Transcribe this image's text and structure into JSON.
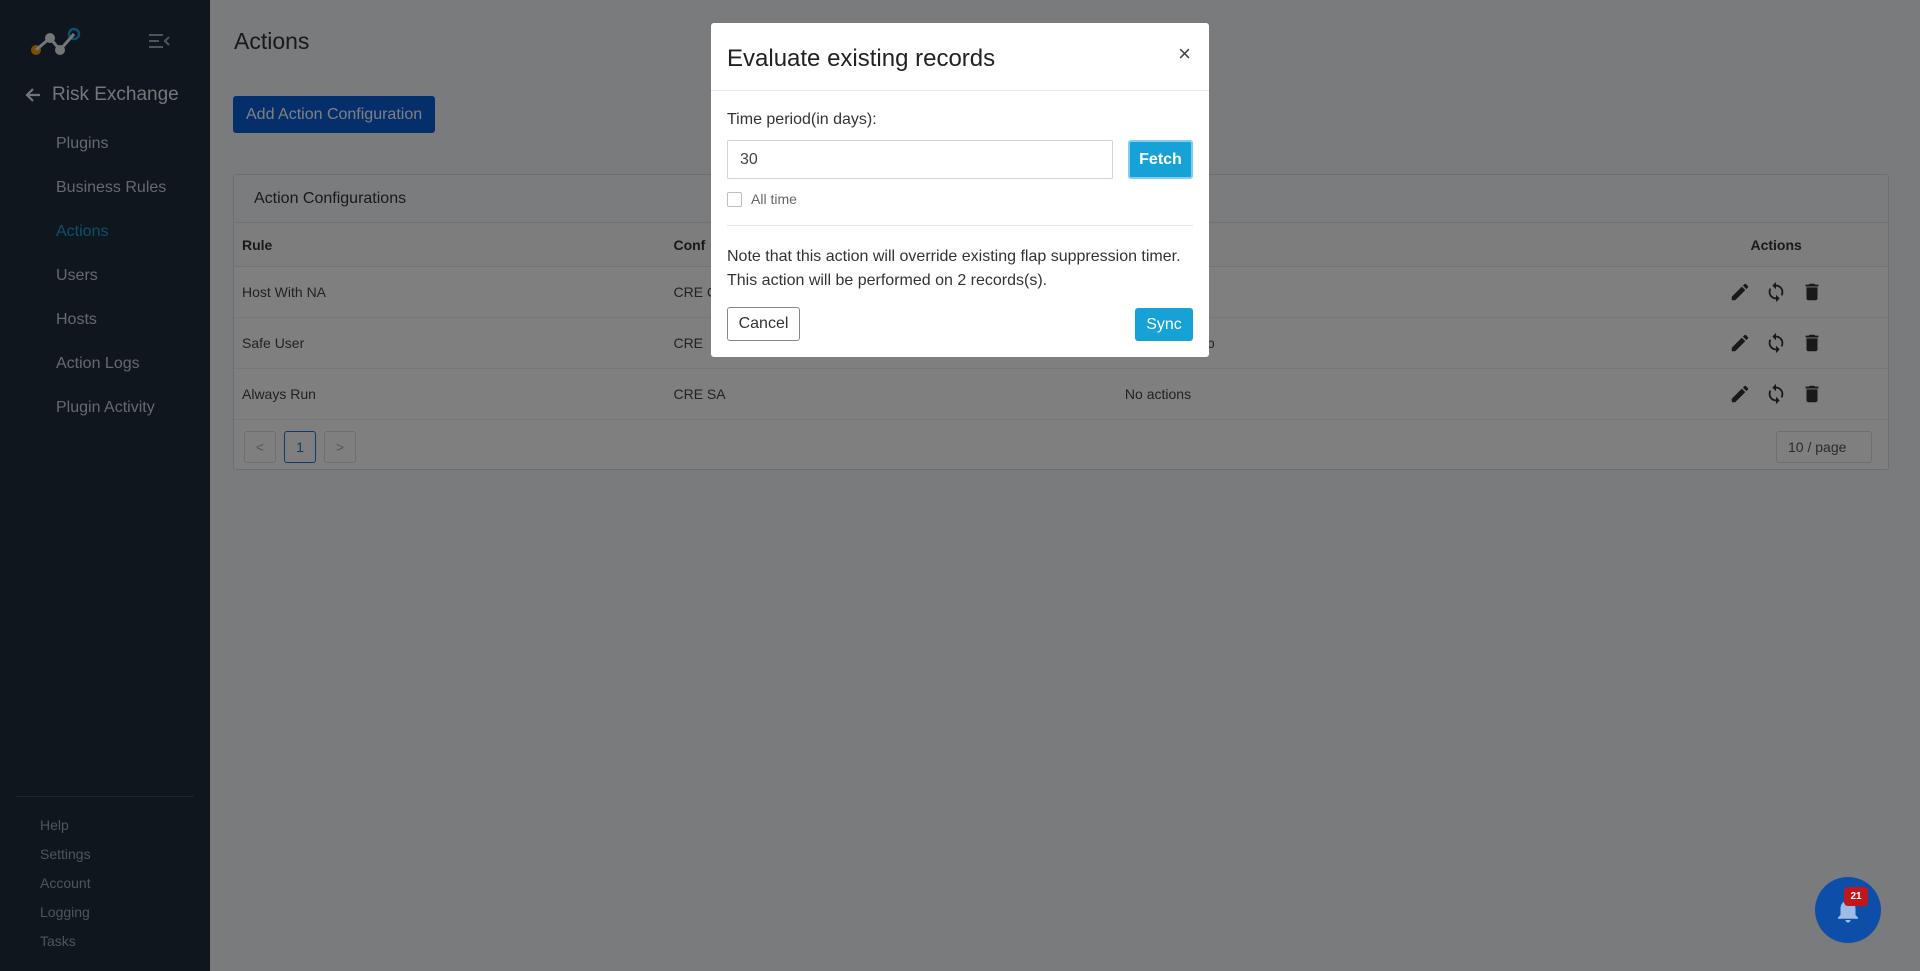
{
  "sidebar": {
    "back_title": "Risk Exchange",
    "nav_items": [
      "Plugins",
      "Business Rules",
      "Actions",
      "Users",
      "Hosts",
      "Action Logs",
      "Plugin Activity"
    ],
    "active_item": "Actions",
    "bottom_items": [
      "Help",
      "Settings",
      "Account",
      "Logging",
      "Tasks"
    ]
  },
  "main": {
    "page_title": "Actions",
    "add_button": "Add Action Configuration",
    "card_title": "Action Configurations",
    "columns": [
      "Rule",
      "Conf",
      "",
      "Actions"
    ],
    "rows": [
      {
        "rule": "Host With NA",
        "config": "CRE C",
        "actions": ""
      },
      {
        "rule": "Safe User",
        "config": "CRE",
        "actions": "p"
      },
      {
        "rule": "Always Run",
        "config": "CRE SA",
        "actions": "No actions"
      }
    ],
    "pagination": {
      "prev": "<",
      "current": "1",
      "next": ">"
    },
    "per_page": "10 / page"
  },
  "modal": {
    "title": "Evaluate existing records",
    "close": "×",
    "field_label": "Time period(in days):",
    "days_value": "30",
    "fetch_button": "Fetch",
    "all_time_label": "All time",
    "note_line1": "Note that this action will override existing flap suppression timer.",
    "note_line2": "This action will be performed on 2 records(s).",
    "cancel_button": "Cancel",
    "sync_button": "Sync"
  },
  "notifications": {
    "count": "21"
  },
  "colors": {
    "sidebar_bg": "#1f2d3d",
    "accent": "#17a2d7",
    "primary": "#0a5ed7",
    "badge": "#c0161c"
  }
}
